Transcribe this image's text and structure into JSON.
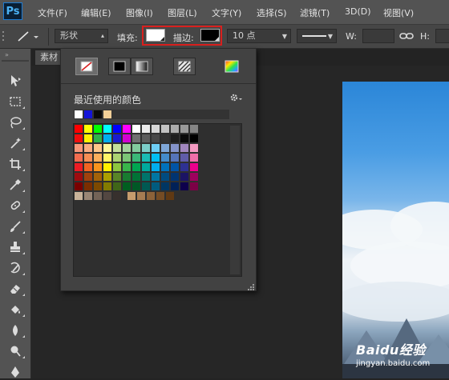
{
  "app": {
    "logo": "Ps"
  },
  "menu": [
    {
      "label": "文件(F)"
    },
    {
      "label": "编辑(E)"
    },
    {
      "label": "图像(I)"
    },
    {
      "label": "图层(L)"
    },
    {
      "label": "文字(Y)"
    },
    {
      "label": "选择(S)"
    },
    {
      "label": "滤镜(T)"
    },
    {
      "label": "3D(D)"
    },
    {
      "label": "视图(V)"
    }
  ],
  "options": {
    "tool_icon": "line-tool-icon",
    "mode": {
      "value": "形状"
    },
    "fill_label": "填充:",
    "fill_color": "#ffffff",
    "stroke_label": "描边:",
    "stroke_color": "#000000",
    "stroke_width": "10 点",
    "width_label": "W:",
    "height_label": "H:",
    "highlight_color": "#d9201e"
  },
  "document": {
    "tab_label": "素材"
  },
  "picker": {
    "type_buttons": [
      {
        "name": "no-color",
        "icon": "no-color-icon"
      },
      {
        "name": "solid-color",
        "icon": "solid-color-icon"
      },
      {
        "name": "gradient",
        "icon": "gradient-icon"
      },
      {
        "name": "pattern",
        "icon": "pattern-icon"
      },
      {
        "name": "color-picker",
        "icon": "color-picker-icon"
      }
    ],
    "selected_type": "no-color",
    "recent_title": "最近使用的颜色",
    "recent_colors": [
      "#ffffff",
      "#1414d8",
      "#0a0a0a",
      "#f2cf98"
    ],
    "swatch_rows": [
      [
        "#ff0000",
        "#ffff00",
        "#00ff00",
        "#00ffff",
        "#0000ff",
        "#ff00ff",
        "#ffffff",
        "#ebebeb",
        "#d6d6d6",
        "#c2c2c2",
        "#adadad",
        "#999999",
        "#858585"
      ],
      [
        "#f20d0d",
        "#fff200",
        "#2fb34a",
        "#00aeef",
        "#1b1bd1",
        "#d200d2",
        "#707070",
        "#5c5c5c",
        "#474747",
        "#333333",
        "#1f1f1f",
        "#0a0a0a",
        "#000000"
      ],
      [
        "#f7977a",
        "#f9ad81",
        "#fdc68a",
        "#fff79a",
        "#c4df9b",
        "#a3d39c",
        "#82ca9d",
        "#7bcdc8",
        "#6ecff6",
        "#7ea7d8",
        "#8493ca",
        "#a187be",
        "#f49ac2"
      ],
      [
        "#f26c4f",
        "#f68e55",
        "#fbaf5c",
        "#fff467",
        "#acd372",
        "#7cc576",
        "#3bb878",
        "#1abbb4",
        "#00bff3",
        "#448ccb",
        "#5574b9",
        "#605ca8",
        "#f06ea9"
      ],
      [
        "#ed1c24",
        "#f26522",
        "#f7941d",
        "#fff200",
        "#8dc73f",
        "#39b54a",
        "#00a651",
        "#00a99d",
        "#00aeef",
        "#0072bc",
        "#0054a6",
        "#2e3192",
        "#ec008c"
      ],
      [
        "#9e0b0f",
        "#a0410d",
        "#a36209",
        "#aba000",
        "#598527",
        "#197b30",
        "#007236",
        "#00746b",
        "#0076a3",
        "#004b80",
        "#003471",
        "#1b1464",
        "#9e005d"
      ],
      [
        "#790000",
        "#7b2e00",
        "#7d4900",
        "#827b00",
        "#406618",
        "#005e20",
        "#005826",
        "#005952",
        "#005b7f",
        "#003663",
        "#002157",
        "#0d004c",
        "#7b0046"
      ],
      [
        "#c7b299",
        "#998675",
        "#736357",
        "#534741",
        "#37302d",
        "#c69c6d",
        "#a67c52",
        "#8c6239",
        "#754c24",
        "#603913"
      ]
    ]
  },
  "toolbar": {
    "tools": [
      "move-tool-icon",
      "marquee-tool-icon",
      "lasso-tool-icon",
      "magic-wand-tool-icon",
      "crop-tool-icon",
      "eyedropper-tool-icon",
      "healing-brush-tool-icon",
      "brush-tool-icon",
      "clone-stamp-tool-icon",
      "history-brush-tool-icon",
      "eraser-tool-icon",
      "paint-bucket-tool-icon",
      "blur-tool-icon",
      "dodge-tool-icon",
      "pen-tool-icon"
    ]
  },
  "watermark": {
    "main": "Baidu经验",
    "sub": "jingyan.baidu.com"
  }
}
